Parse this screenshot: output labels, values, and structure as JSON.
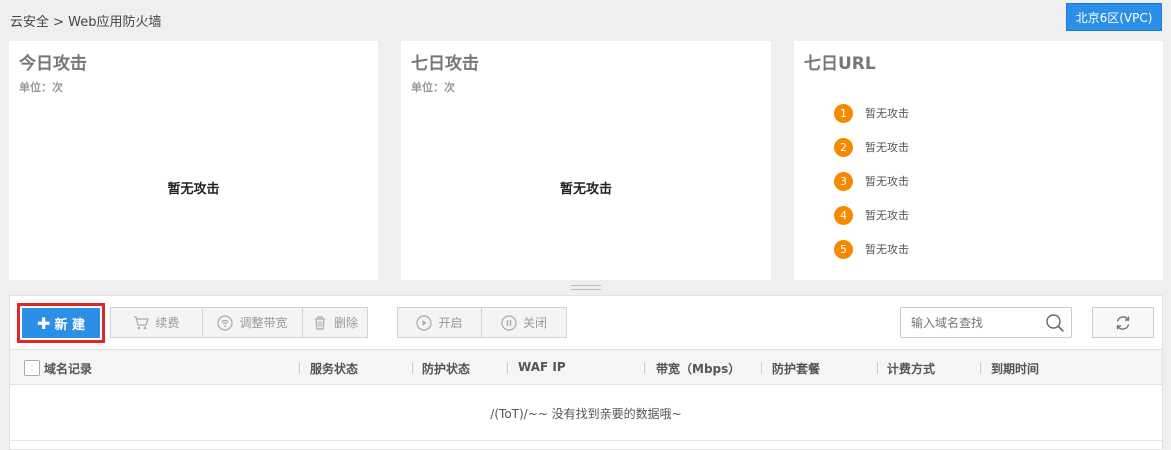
{
  "breadcrumb": "云安全 > Web应用防火墙",
  "region_button": "北京6区(VPC)",
  "cards": {
    "today": {
      "title": "今日攻击",
      "unit": "单位：次",
      "empty": "暂无攻击"
    },
    "week": {
      "title": "七日攻击",
      "unit": "单位：次",
      "empty": "暂无攻击"
    },
    "url": {
      "title": "七日URL",
      "items": [
        {
          "num": "1",
          "label": "暂无攻击"
        },
        {
          "num": "2",
          "label": "暂无攻击"
        },
        {
          "num": "3",
          "label": "暂无攻击"
        },
        {
          "num": "4",
          "label": "暂无攻击"
        },
        {
          "num": "5",
          "label": "暂无攻击"
        }
      ]
    }
  },
  "toolbar": {
    "new_label": "新 建",
    "renew_label": "续费",
    "bandwidth_label": "调整带宽",
    "delete_label": "删除",
    "enable_label": "开启",
    "disable_label": "关闭",
    "search_placeholder": "输入域名查找"
  },
  "table": {
    "columns": [
      "域名记录",
      "服务状态",
      "防护状态",
      "WAF IP",
      "带宽（Mbps）",
      "防护套餐",
      "计费方式",
      "到期时间"
    ],
    "empty_text": "/(ToT)/~~ 没有找到亲要的数据哦~"
  },
  "colors": {
    "accent": "#2b8fe8",
    "highlight": "#e0262d",
    "rank_badge": "#f58a00"
  }
}
